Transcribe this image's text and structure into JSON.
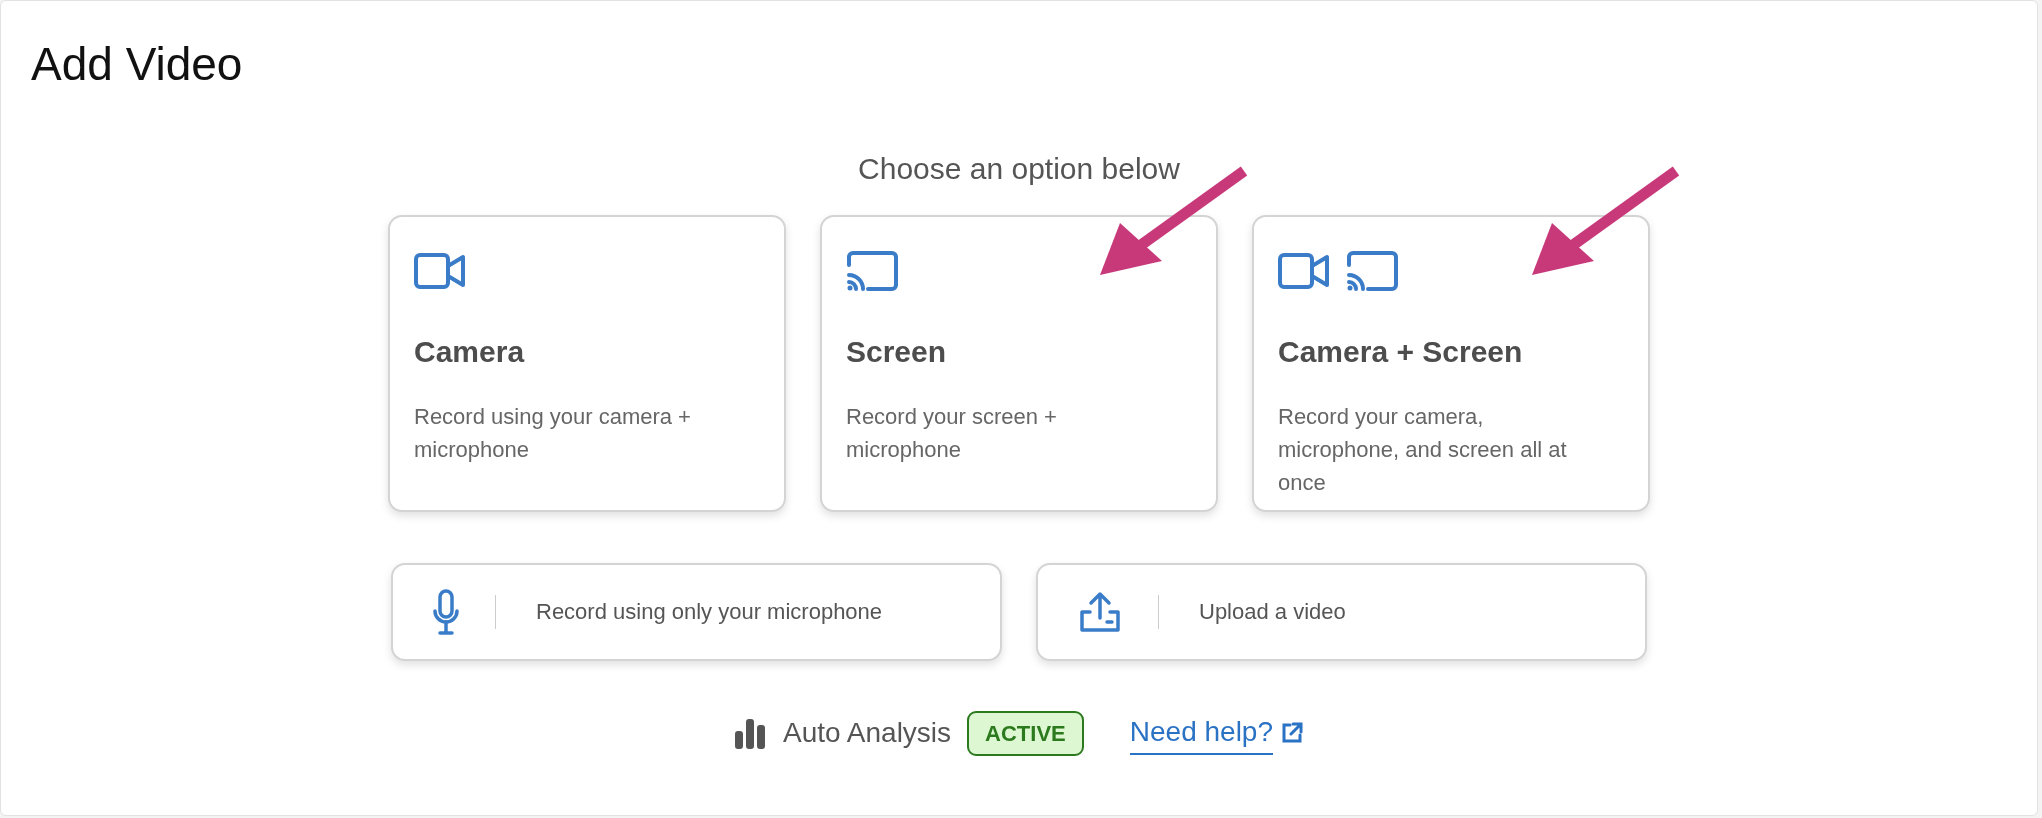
{
  "page_title": "Add Video",
  "prompt": "Choose an option below",
  "options": [
    {
      "kind": "camera",
      "title": "Camera",
      "description": "Record using your camera + microphone",
      "arrow": false
    },
    {
      "kind": "screen",
      "title": "Screen",
      "description": "Record your screen + microphone",
      "arrow": true
    },
    {
      "kind": "camera_screen",
      "title": "Camera + Screen",
      "description": "Record your camera, microphone, and screen all at once",
      "arrow": true
    }
  ],
  "secondary_options": [
    {
      "kind": "microphone",
      "label": "Record using only your microphone"
    },
    {
      "kind": "upload",
      "label": "Upload a video"
    }
  ],
  "footer": {
    "feature": "Auto Analysis",
    "status": "ACTIVE",
    "help_link": "Need help?"
  }
}
